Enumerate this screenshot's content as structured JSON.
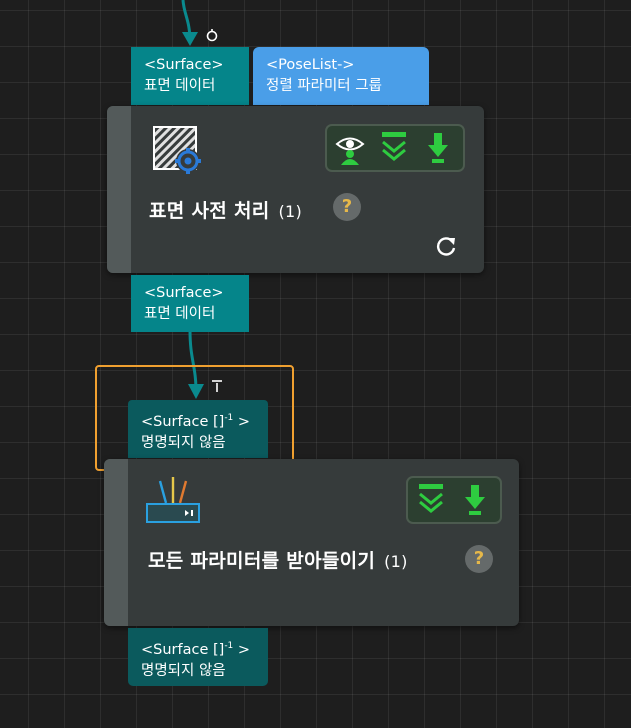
{
  "node1": {
    "input_ports": [
      {
        "type": "<Surface>",
        "name": "표면 데이터"
      },
      {
        "type": "<PoseList->",
        "name": "정렬 파라미터 그룹"
      }
    ],
    "title": "표면 사전 처리",
    "count": "(1)",
    "help_label": "?",
    "output_port": {
      "type": "<Surface>",
      "name": "표면 데이터"
    },
    "toolbar_icons": [
      "eye-person-icon",
      "chevron-down-double-icon",
      "download-arrow-icon"
    ],
    "node_icon": "surface-processing-icon",
    "colors": {
      "port": "#05858a",
      "port_blue": "#4a9ee8",
      "node_bg": "#363b3b",
      "accent": "#2ecc40"
    }
  },
  "node2": {
    "input_port": {
      "type": "<Surface []",
      "sup": "-1",
      "type_end": " >",
      "name": "명명되지 않음"
    },
    "title": "모든 파라미터를 받아들이기",
    "count": "(1)",
    "help_label": "?",
    "output_port": {
      "type": "<Surface []",
      "sup": "-1",
      "type_end": " >",
      "name": "명명되지 않음"
    },
    "toolbar_icons": [
      "chevron-down-double-icon",
      "download-arrow-icon"
    ],
    "node_icon": "router-device-icon",
    "colors": {
      "port": "#0b5a5d",
      "selection": "#f0a030"
    }
  }
}
